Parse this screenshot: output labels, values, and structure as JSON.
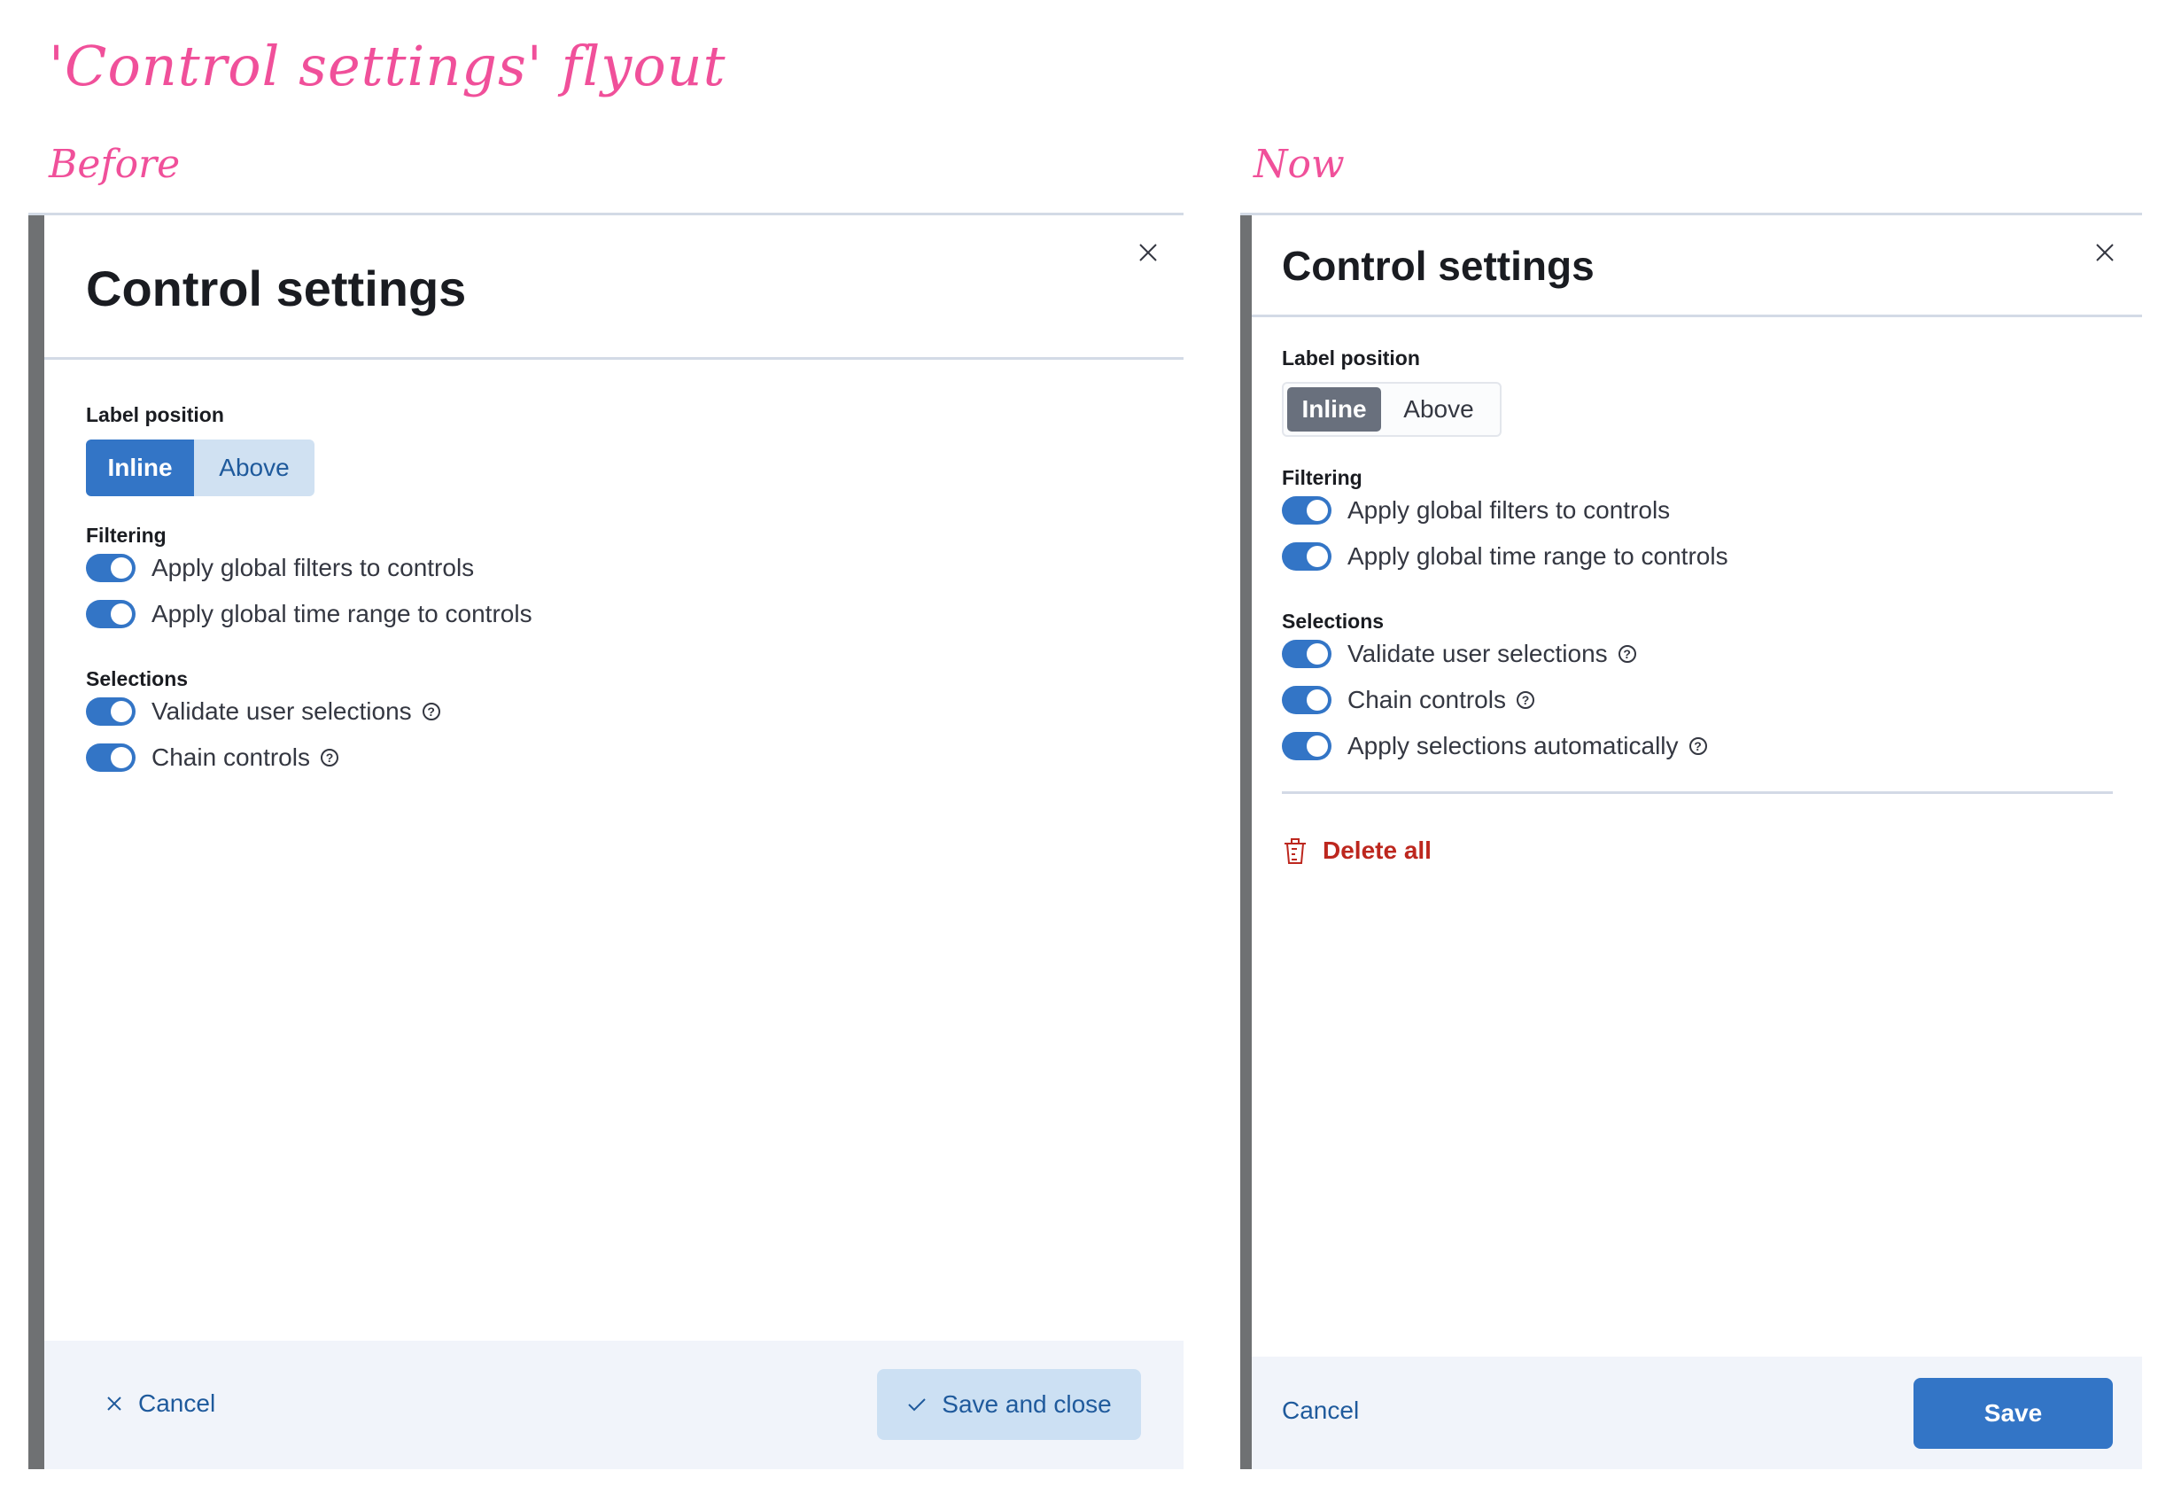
{
  "annotations": {
    "title": "'Control settings' flyout",
    "before_label": "Before",
    "now_label": "Now"
  },
  "before": {
    "title": "Control settings",
    "label_position": {
      "label": "Label position",
      "options": [
        "Inline",
        "Above"
      ],
      "selected": "Inline"
    },
    "sections": [
      {
        "label": "Filtering",
        "toggles": [
          {
            "label": "Apply global filters to controls",
            "on": true,
            "help": false
          },
          {
            "label": "Apply global time range to controls",
            "on": true,
            "help": false
          }
        ]
      },
      {
        "label": "Selections",
        "toggles": [
          {
            "label": "Validate user selections",
            "on": true,
            "help": true
          },
          {
            "label": "Chain controls",
            "on": true,
            "help": true
          }
        ]
      }
    ],
    "footer": {
      "cancel": "Cancel",
      "save": "Save and close"
    }
  },
  "now": {
    "title": "Control settings",
    "label_position": {
      "label": "Label position",
      "options": [
        "Inline",
        "Above"
      ],
      "selected": "Inline"
    },
    "sections": [
      {
        "label": "Filtering",
        "toggles": [
          {
            "label": "Apply global filters to controls",
            "on": true,
            "help": false
          },
          {
            "label": "Apply global time range to controls",
            "on": true,
            "help": false
          }
        ]
      },
      {
        "label": "Selections",
        "toggles": [
          {
            "label": "Validate user selections",
            "on": true,
            "help": true
          },
          {
            "label": "Chain controls",
            "on": true,
            "help": true
          },
          {
            "label": "Apply selections automatically",
            "on": true,
            "help": true
          }
        ]
      }
    ],
    "delete_all": "Delete all",
    "footer": {
      "cancel": "Cancel",
      "save": "Save"
    }
  },
  "colors": {
    "annotation": "#f0509a",
    "primary": "#3375c6",
    "danger": "#bd271e",
    "link": "#1f5a9c"
  },
  "icons": {
    "help": "?"
  }
}
